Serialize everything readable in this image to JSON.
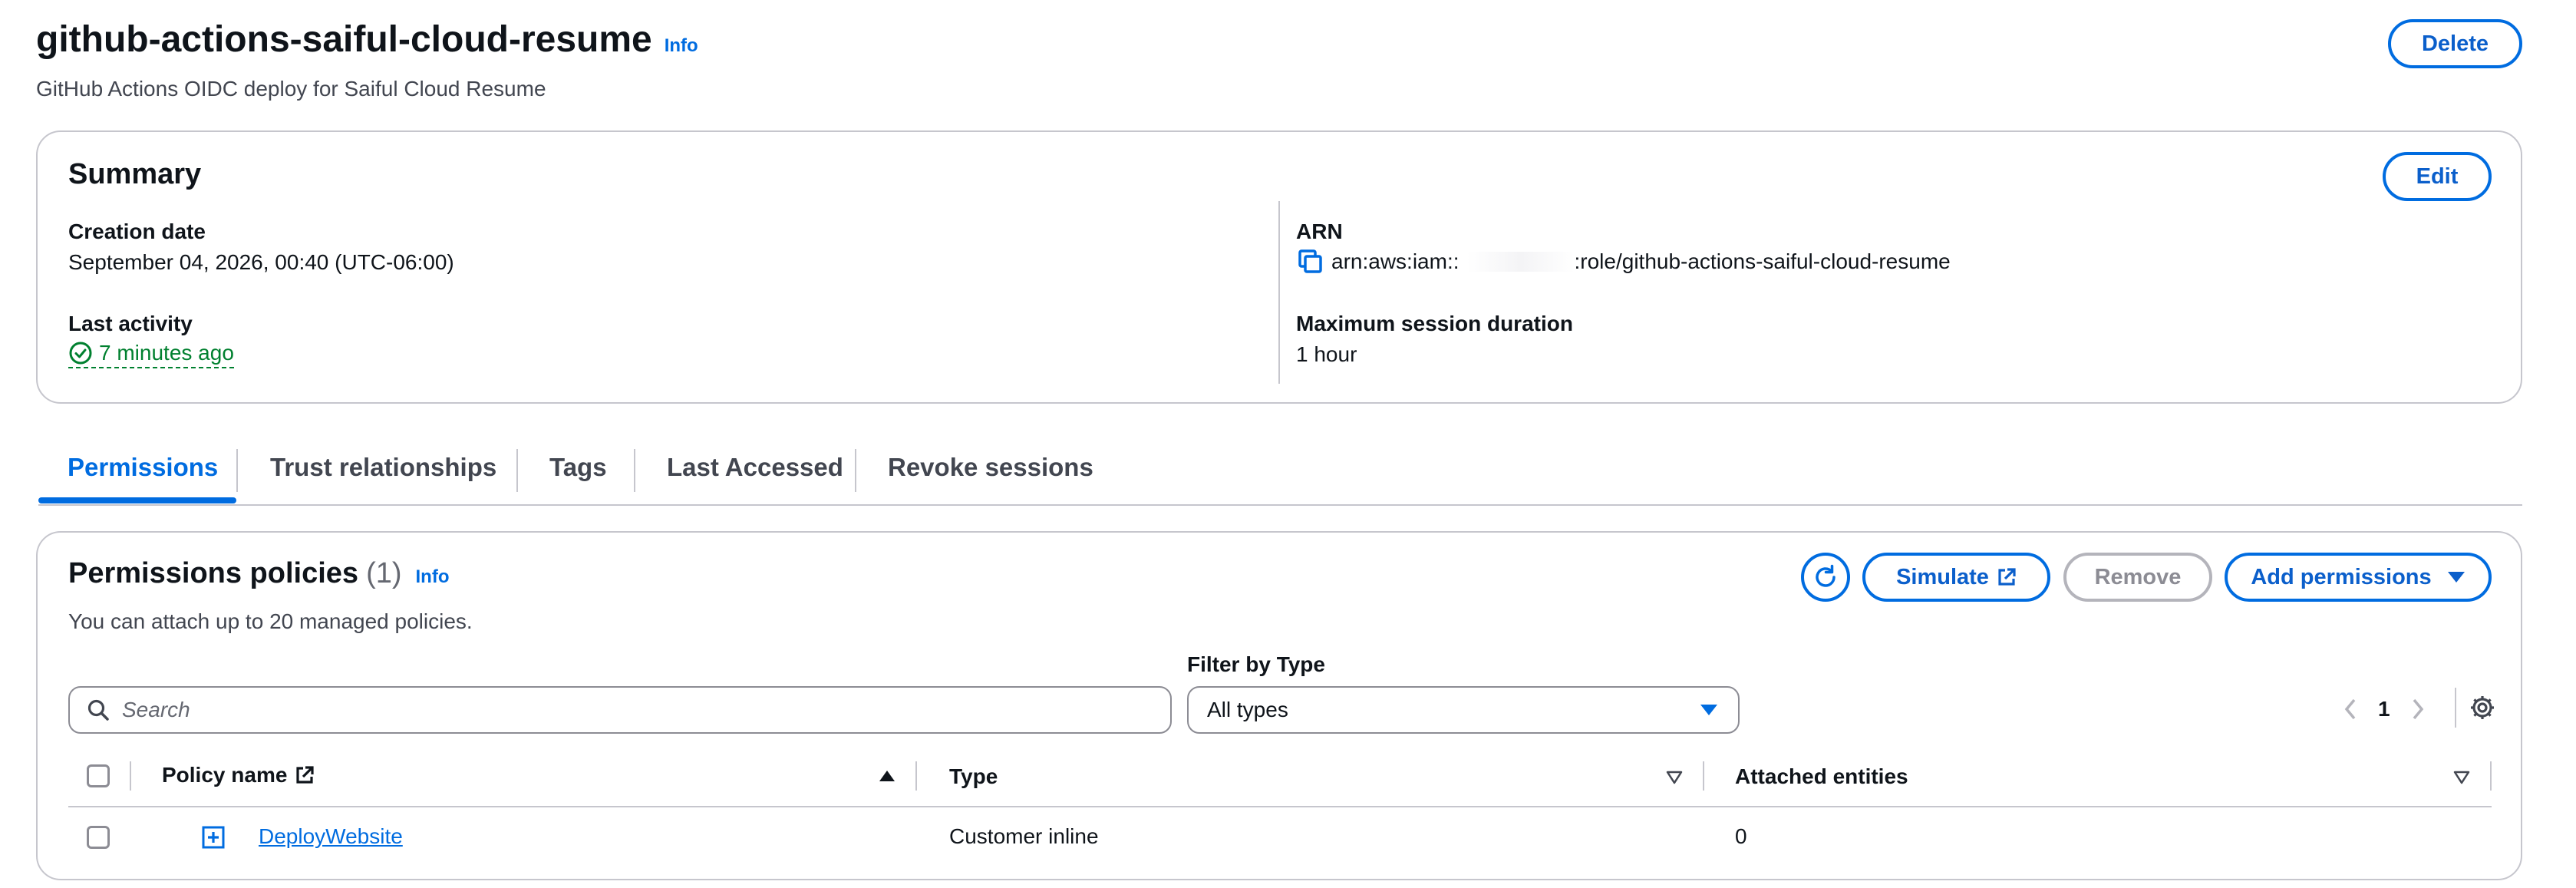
{
  "header": {
    "title": "github-actions-saiful-cloud-resume",
    "info": "Info",
    "description": "GitHub Actions OIDC deploy for Saiful Cloud Resume",
    "delete_label": "Delete"
  },
  "summary": {
    "title": "Summary",
    "edit_label": "Edit",
    "creation_date_label": "Creation date",
    "creation_date_value": "September 04, 2026, 00:40 (UTC-06:00)",
    "last_activity_label": "Last activity",
    "last_activity_value": "7 minutes ago",
    "arn_label": "ARN",
    "arn_prefix": "arn:aws:iam::",
    "arn_suffix": ":role/github-actions-saiful-cloud-resume",
    "max_session_label": "Maximum session duration",
    "max_session_value": "1 hour"
  },
  "tabs": [
    {
      "label": "Permissions",
      "active": true
    },
    {
      "label": "Trust relationships"
    },
    {
      "label": "Tags"
    },
    {
      "label": "Last Accessed"
    },
    {
      "label": "Revoke sessions"
    }
  ],
  "policies": {
    "title": "Permissions policies",
    "count": "(1)",
    "info": "Info",
    "subtitle": "You can attach up to 20 managed policies.",
    "simulate_label": "Simulate",
    "remove_label": "Remove",
    "add_label": "Add permissions",
    "search_placeholder": "Search",
    "filter_label": "Filter by Type",
    "filter_value": "All types",
    "page_number": "1",
    "columns": [
      "Policy name",
      "Type",
      "Attached entities"
    ],
    "rows": [
      {
        "name": "DeployWebsite",
        "type": "Customer inline",
        "attached": "0"
      }
    ]
  },
  "colors": {
    "accent": "#006ce0",
    "success": "#00802f",
    "border": "#c6c6cd"
  }
}
